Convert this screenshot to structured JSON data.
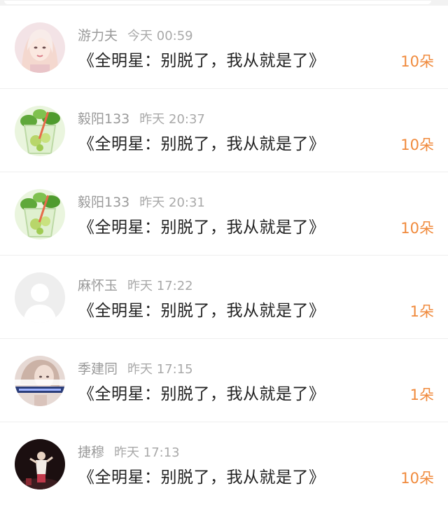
{
  "gift_list": {
    "items": [
      {
        "user": "游力夫",
        "time": "今天 00:59",
        "title": "《全明星：别脱了，我从就是了》",
        "count": "10朵",
        "avatar": "avatar-girl-pink"
      },
      {
        "user": "毅阳133",
        "time": "昨天 20:37",
        "title": "《全明星：别脱了，我从就是了》",
        "count": "10朵",
        "avatar": "avatar-mojito-drink"
      },
      {
        "user": "毅阳133",
        "time": "昨天 20:31",
        "title": "《全明星：别脱了，我从就是了》",
        "count": "10朵",
        "avatar": "avatar-mojito-drink"
      },
      {
        "user": "麻怀玉",
        "time": "昨天 17:22",
        "title": "《全明星：别脱了，我从就是了》",
        "count": "1朵",
        "avatar": "avatar-default-gray"
      },
      {
        "user": "季建同",
        "time": "昨天 17:15",
        "title": "《全明星：别脱了，我从就是了》",
        "count": "1朵",
        "avatar": "avatar-girl-caption"
      },
      {
        "user": "捷穆",
        "time": "昨天 17:13",
        "title": "《全明星：别脱了，我从就是了》",
        "count": "10朵",
        "avatar": "avatar-dark-figure"
      }
    ]
  },
  "colors": {
    "accent": "#f08a3c",
    "username": "#9a9a9a",
    "title": "#222222",
    "divider": "#efefef"
  }
}
